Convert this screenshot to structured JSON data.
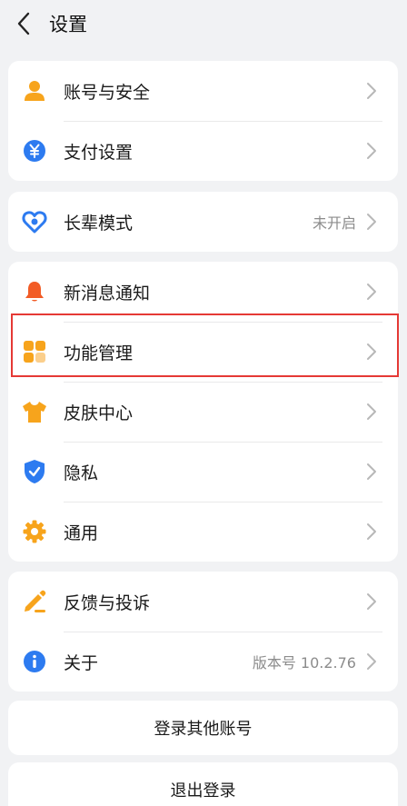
{
  "header": {
    "title": "设置"
  },
  "group1": [
    {
      "label": "账号与安全",
      "icon": "person-icon",
      "color": "#f7a41c"
    },
    {
      "label": "支付设置",
      "icon": "yuan-icon",
      "color": "#2d7bf0"
    }
  ],
  "group2": [
    {
      "label": "长辈模式",
      "value": "未开启",
      "icon": "heart-icon",
      "color": "#2d7bf0"
    }
  ],
  "group3": [
    {
      "label": "新消息通知",
      "icon": "bell-icon",
      "color": "#f25c26"
    },
    {
      "label": "功能管理",
      "icon": "grid-icon",
      "color": "#f7a41c",
      "highlighted": true
    },
    {
      "label": "皮肤中心",
      "icon": "shirt-icon",
      "color": "#f7a41c"
    },
    {
      "label": "隐私",
      "icon": "shield-icon",
      "color": "#2d7bf0"
    },
    {
      "label": "通用",
      "icon": "gear-icon",
      "color": "#f7a41c"
    }
  ],
  "group4": [
    {
      "label": "反馈与投诉",
      "icon": "pencil-icon",
      "color": "#f7a41c"
    },
    {
      "label": "关于",
      "value": "版本号 10.2.76",
      "icon": "info-icon",
      "color": "#2d7bf0"
    }
  ],
  "buttons": {
    "switch_account": "登录其他账号",
    "logout": "退出登录"
  },
  "colors": {
    "background": "#f1f2f4",
    "highlight": "#e53935",
    "chevron": "#b8b8b8"
  }
}
